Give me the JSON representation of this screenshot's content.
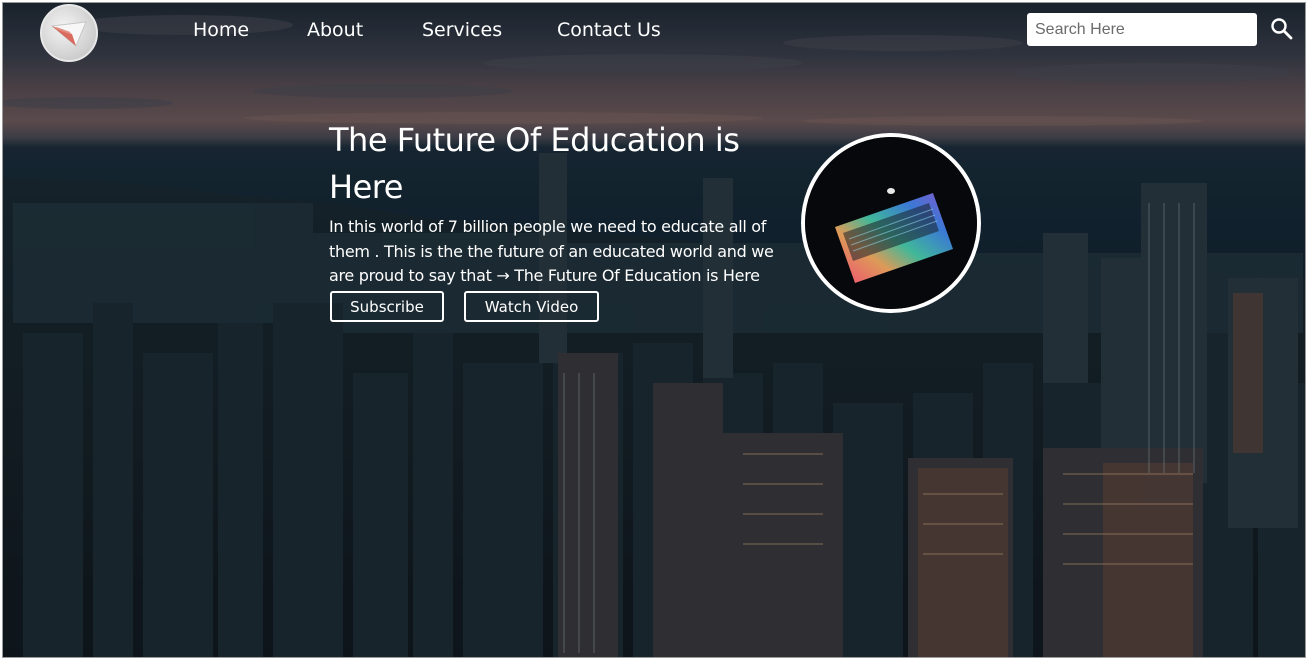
{
  "nav": {
    "items": [
      {
        "label": "Home"
      },
      {
        "label": "About"
      },
      {
        "label": "Services"
      },
      {
        "label": "Contact Us"
      }
    ],
    "search": {
      "placeholder": "Search Here",
      "value": "",
      "icon": "search-icon"
    },
    "logo_icon": "logo-icon"
  },
  "hero": {
    "title": "The Future Of Education is Here",
    "description": "In this world of 7 billion people we need to educate all of them . This is the the future of an educated world and we are proud to say that → The Future Of Education is Here",
    "buttons": {
      "subscribe": "Subscribe",
      "watch_video": "Watch Video"
    },
    "image_icon": "laptop-image"
  },
  "colors": {
    "text": "#ffffff",
    "button_border": "#ffffff",
    "search_bg": "#ffffff",
    "overlay": "#0d1a24"
  }
}
